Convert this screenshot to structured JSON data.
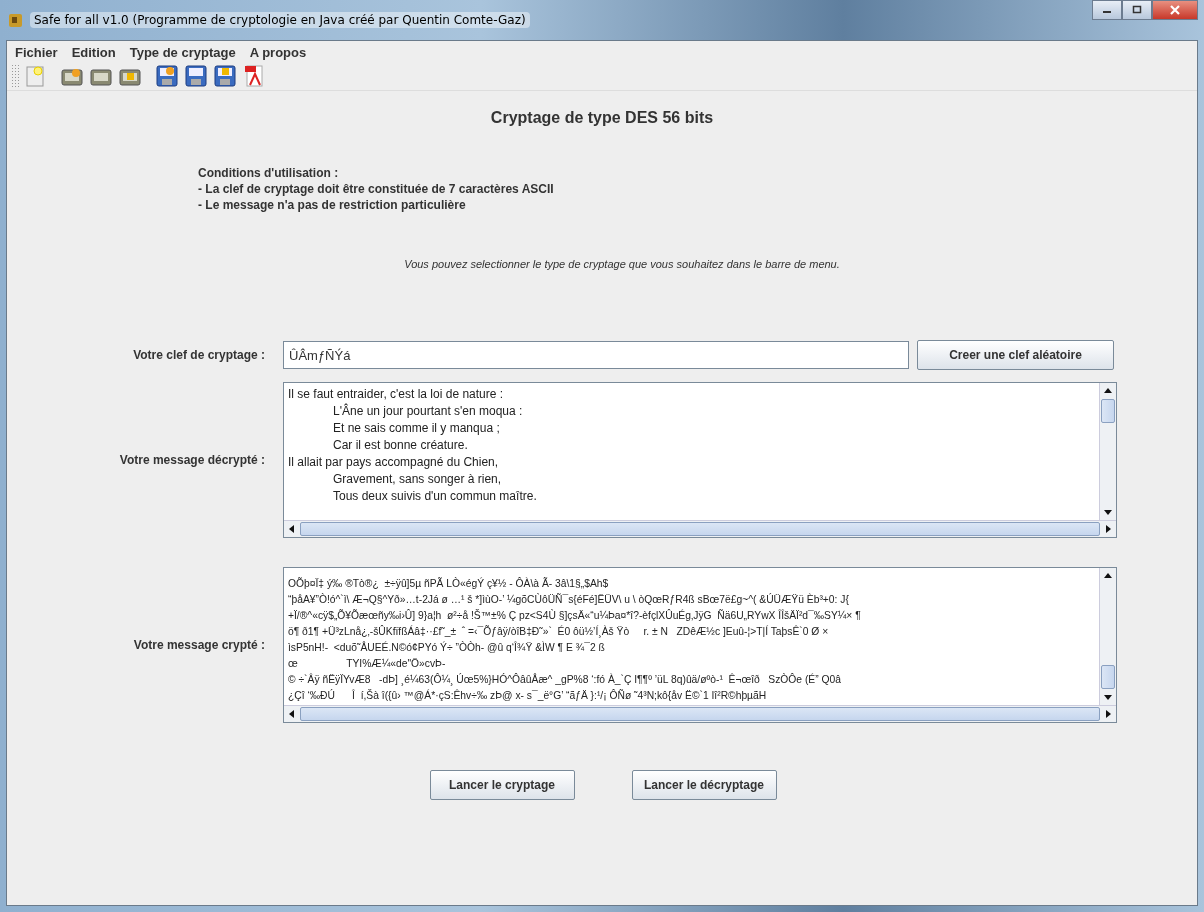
{
  "window": {
    "title": "Safe for all v1.0 (Programme de cryptologie en Java créé par Quentin Comte-Gaz)"
  },
  "menu": [
    "Fichier",
    "Edition",
    "Type de cryptage",
    "A propos"
  ],
  "toolbar": [
    {
      "kind": "new"
    },
    {
      "kind": "open-key"
    },
    {
      "kind": "open"
    },
    {
      "kind": "open-lock"
    },
    {
      "kind": "save-key"
    },
    {
      "kind": "save"
    },
    {
      "kind": "save-lock"
    },
    {
      "kind": "pdf"
    }
  ],
  "heading": "Cryptage de type DES 56 bits",
  "conditions": [
    "Conditions d'utilisation :",
    "- La clef de cryptage doit être constituée de 7 caractères ASCII",
    "- Le message n'a pas de restriction particulière"
  ],
  "note": "Vous pouvez selectionner le type de cryptage que vous souhaitez dans le barre de menu.",
  "key": {
    "label": "Votre clef de cryptage :",
    "value": "ÛÂmƒÑÝá",
    "button": "Creer une clef aléatoire"
  },
  "decrypted": {
    "label": "Votre message décrypté :",
    "lines": [
      "Il se faut entraider, c'est la loi de nature :",
      "\tL'Âne un jour pourtant s'en moqua :",
      "\tEt ne sais comme il y manqua ;",
      "\tCar il est bonne créature.",
      "Il allait par pays accompagné du Chien,",
      "\tGravement, sans songer à rien,",
      "\tTous deux suivis d'un commun maître."
    ]
  },
  "encrypted": {
    "label": "Votre message crypté :",
    "lines": [
      "OÕþ¤Ï‡ ý‰ ®Tò®¿  ±÷ÿû]5µ ñPÃ LÒ«égÝ ç¥½ - ÔÀ\\à Ã- 3â\\1§„$Ah$",
      "“þåA¥”Ò!ó^`ì\\ Æ¬Q§^Yð»…t-2Já ø …¹ š *]ìùO-’ ¼gõCÙôÜÑ¯s{éFé]ËÜV\\ u \\ òQœRƒR4ß sBœ7ë£g~^( &ÚÜÆŸü Èb³+0: J{",
      "+Ï/®^«cÿ$„Õ¥Õæœñy‰i›Û] 9}a¦h  ø²÷å !Š™±% Ç pz<S4Ù §]çsÄ«“u¼Þa¤*î?-èfçlXÛuÉg‚JÿG  Ñä6U„RYwX ÎÎšÄÏ²d¯‰SY¼× ¶",
      "ö¶ ð1¶ +Ü³zLnå¿‚-šÛKfïfßÁâ‡··£f˜_±  ˆ =‹¯Õƒâÿ/òîB‡Ð˜»`  É0 ôü½’Í¸Àš Ÿò     r. ± N   ZDêÆ½c ]Euû-¦>T|Í TaþsÊ`0 Ø ×",
      "ìsP5nH!-  <duõ˜ÅUEÉ.N©ó¢PYó Ý÷ ”ÒÒh- @û q‘Î¾Ÿ &ÌW ¶ E ¾¯2 ß",
      "œ                 TYI%Æ¼«de\"Ö»cvÞ-",
      "© ÷`Âÿ ñËÿÏYvÆ8   -dÞ] ¸é¼63(Ô¼¸ Úœ5%}HÓ^ÔâûÅæ^ _gP%8 ‘:fó À_`Ç I¶¶º ’üL 8q)ûä/øºò-¹  Ê¬œîð   SzÒÔe (É” Q0â",
      "¿Çî ‘‰ÐÚ      Î  í,Šà î({û› ™@Á*·çS:Êhv÷‰ zÞ@ x- s¯_ë°G’ “ãƒÄ }:¹/¡ ÔÑø ˜4³N;kô{åv Ë©`1 Iî²R©hþµãH"
    ]
  },
  "actions": [
    "Lancer le cryptage",
    "Lancer le décryptage"
  ]
}
